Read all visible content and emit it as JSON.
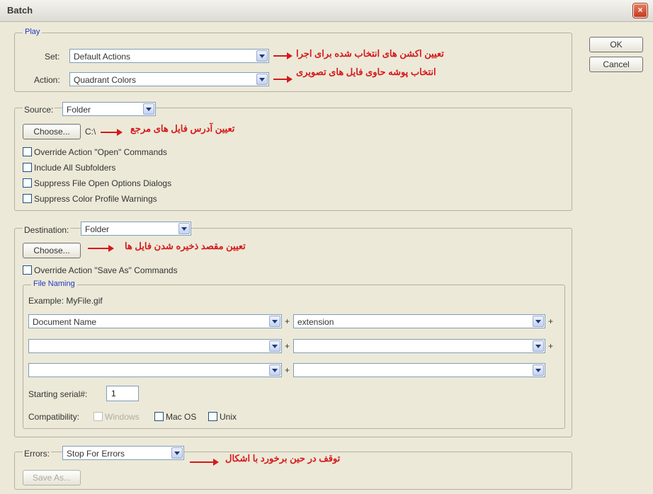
{
  "window": {
    "title": "Batch",
    "close_glyph": "×"
  },
  "buttons": {
    "ok": "OK",
    "cancel": "Cancel"
  },
  "play": {
    "legend": "Play",
    "set_label": "Set:",
    "set_value": "Default Actions",
    "action_label": "Action:",
    "action_value": "Quadrant Colors"
  },
  "source": {
    "label": "Source:",
    "value": "Folder",
    "choose": "Choose...",
    "path": "C:\\",
    "checkboxes": [
      "Override Action \"Open\" Commands",
      "Include All Subfolders",
      "Suppress File Open Options Dialogs",
      "Suppress Color Profile Warnings"
    ]
  },
  "destination": {
    "label": "Destination:",
    "value": "Folder",
    "choose": "Choose...",
    "override": "Override Action \"Save As\" Commands",
    "file_naming": {
      "legend": "File Naming",
      "example": "Example: MyFile.gif",
      "rows": [
        [
          "Document Name",
          "extension"
        ],
        [
          "",
          ""
        ],
        [
          "",
          ""
        ]
      ],
      "plus": "+",
      "serial_label": "Starting serial#:",
      "serial_value": "1",
      "compat_label": "Compatibility:",
      "compat": [
        "Windows",
        "Mac OS",
        "Unix"
      ]
    }
  },
  "errors": {
    "label": "Errors:",
    "value": "Stop For Errors",
    "save_as": "Save As..."
  },
  "annotations": {
    "set": "تعیین اکشن های انتخاب شده برای اجرا",
    "action": "انتخاب پوشه حاوی فایل های تصویری",
    "source": "تعیین آدرس فایل های مرجع",
    "destination": "تعیین مقصد ذخیره شدن فایل ها",
    "errors": "توقف در حین برخورد با اشکال"
  },
  "colors": {
    "annotation": "#d5191b",
    "legend": "#1e3cc0"
  }
}
